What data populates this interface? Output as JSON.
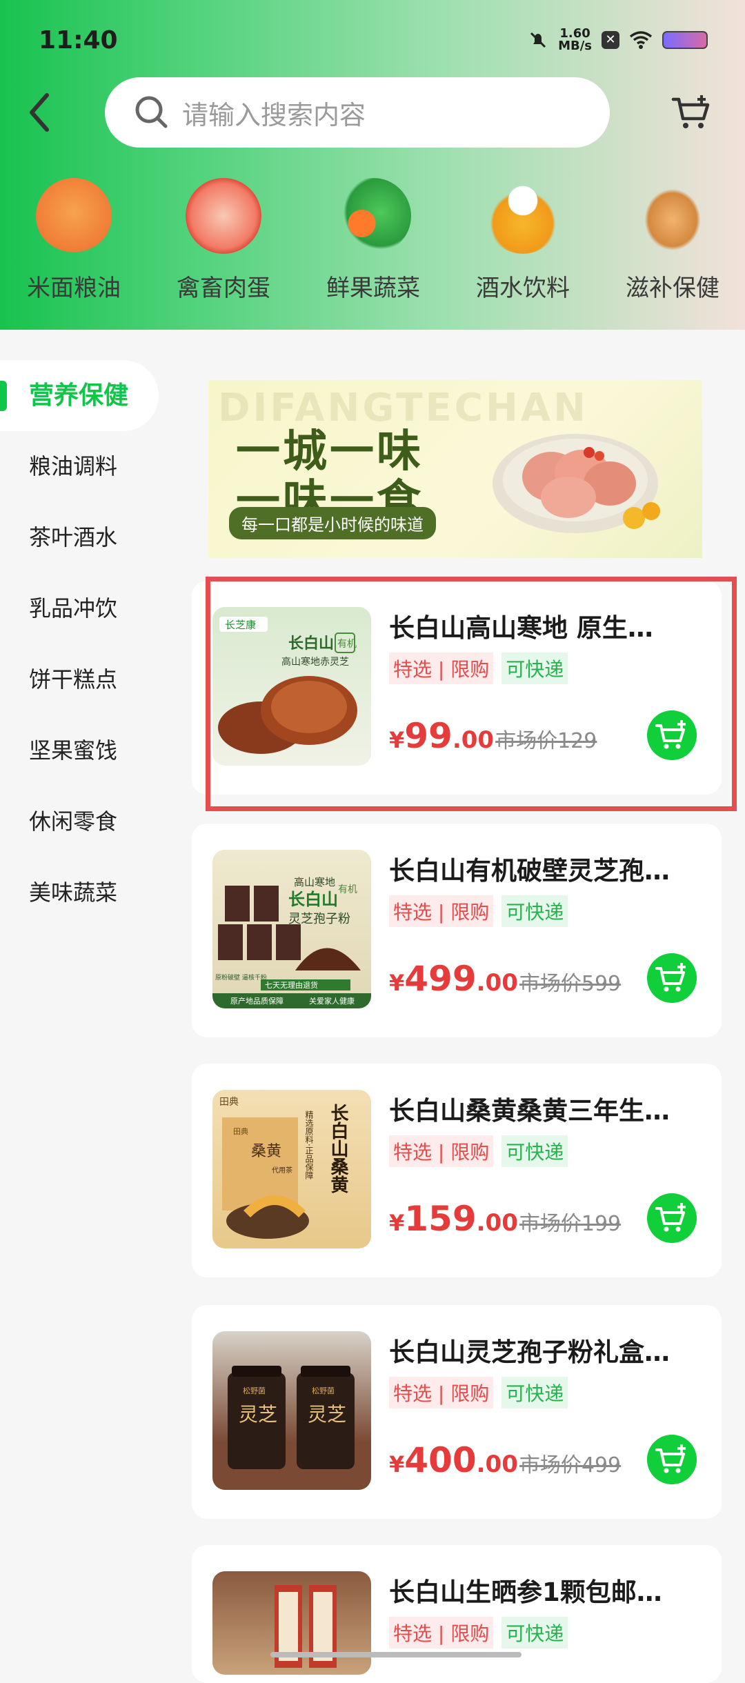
{
  "status": {
    "time": "11:40",
    "net_speed_value": "1.60",
    "net_speed_unit": "MB/s"
  },
  "search": {
    "placeholder": "请输入搜索内容"
  },
  "categories": [
    {
      "label": "米面粮油",
      "icon": "flour-bag-icon"
    },
    {
      "label": "禽畜肉蛋",
      "icon": "meat-icon"
    },
    {
      "label": "鲜果蔬菜",
      "icon": "vegetables-icon"
    },
    {
      "label": "酒水饮料",
      "icon": "beer-icon"
    },
    {
      "label": "滋补保健",
      "icon": "ginseng-icon"
    }
  ],
  "sidebar": {
    "items": [
      {
        "label": "营养保健",
        "active": true
      },
      {
        "label": "粮油调料"
      },
      {
        "label": "茶叶酒水"
      },
      {
        "label": "乳品冲饮"
      },
      {
        "label": "饼干糕点"
      },
      {
        "label": "坚果蜜饯"
      },
      {
        "label": "休闲零食"
      },
      {
        "label": "美味蔬菜"
      }
    ]
  },
  "banner": {
    "watermark": "DIFANGTECHAN",
    "line1": "一城一味",
    "line2": "一味一食",
    "tagline": "每一口都是小时候的味道"
  },
  "tags": {
    "special": "特选",
    "sep": "|",
    "limited": "限购",
    "fast": "可快递"
  },
  "products": [
    {
      "title": "长白山高山寒地 原生…",
      "currency": "¥",
      "price_int": "99",
      "price_dec": ".00",
      "market": "市场价129",
      "thumb_color": "#c9dfb9",
      "brand": "长芝康",
      "thumb_text1": "长白山",
      "thumb_text2": "高山寒地赤灵芝",
      "seal": "有机"
    },
    {
      "title": "长白山有机破壁灵芝孢…",
      "currency": "¥",
      "price_int": "499",
      "price_dec": ".00",
      "market": "市场价599",
      "thumb_color": "#e9e3c7",
      "thumb_text1": "高山寒地",
      "thumb_text2": "长白山",
      "thumb_text3": "灵芝孢子粉",
      "seal": "有机",
      "badge_text": "七天无理由退货",
      "footer_left": "原产地品质保障",
      "footer_right": "关爱家人健康",
      "side_text": "原粉破壁 逼核千粉"
    },
    {
      "title": "长白山桑黄桑黄三年生…",
      "currency": "¥",
      "price_int": "159",
      "price_dec": ".00",
      "market": "市场价199",
      "thumb_color": "#f1d9a8",
      "brand": "田典",
      "thumb_text1": "精选原料·正品保障",
      "thumb_text2": "长白山桑黄",
      "pack_label": "桑黄",
      "pack_brand": "田典",
      "pack_tag": "代用茶"
    },
    {
      "title": "长白山灵芝孢子粉礼盒…",
      "currency": "¥",
      "price_int": "400",
      "price_dec": ".00",
      "market": "市场价499",
      "thumb_color": "#5e4436",
      "jar_text": "灵芝",
      "jar_brand": "松野菌"
    },
    {
      "title": "长白山生晒参1颗包邮…",
      "currency": "¥",
      "price_int": "",
      "price_dec": "",
      "market": "",
      "thumb_color": "#8a5a3f"
    }
  ],
  "colors": {
    "accent": "#10c64a",
    "price": "#e53b3b",
    "highlight": "#e44e4e"
  }
}
